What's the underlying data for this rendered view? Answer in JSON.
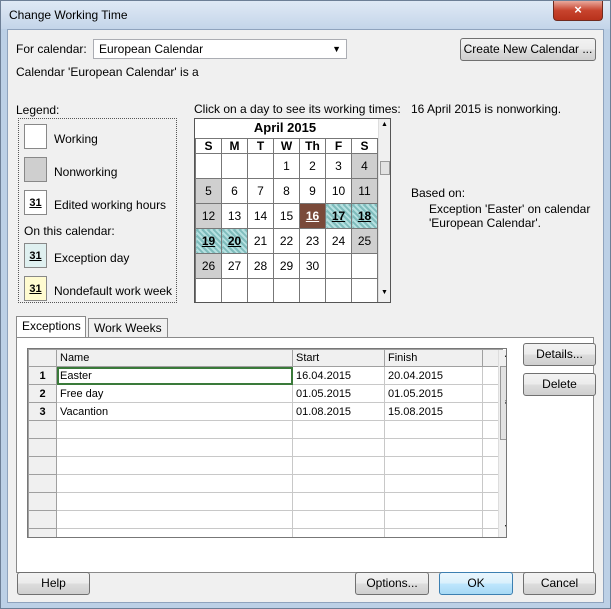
{
  "window": {
    "title": "Change Working Time",
    "close_glyph": "×"
  },
  "for_calendar": {
    "label": "For calendar:",
    "value": "European Calendar"
  },
  "create_calendar_button": "Create New Calendar ...",
  "calendar_info": "Calendar 'European Calendar' is a",
  "legend": {
    "heading": "Legend:",
    "working": "Working",
    "nonworking": "Nonworking",
    "edited": "Edited working hours",
    "sample_day": "31",
    "on_this_calendar": "On this calendar:",
    "exception": "Exception day",
    "nondefault": "Nondefault work week"
  },
  "calendar": {
    "instruction": "Click on a day to see its working times:",
    "month": "April 2015",
    "weekdays": [
      "S",
      "M",
      "T",
      "W",
      "Th",
      "F",
      "S"
    ],
    "weeks": [
      [
        "",
        "",
        "",
        "1",
        "2",
        "3",
        "4"
      ],
      [
        "5",
        "6",
        "7",
        "8",
        "9",
        "10",
        "11"
      ],
      [
        "12",
        "13",
        "14",
        "15",
        "16",
        "17",
        "18"
      ],
      [
        "19",
        "20",
        "21",
        "22",
        "23",
        "24",
        "25"
      ],
      [
        "26",
        "27",
        "28",
        "29",
        "30",
        "",
        ""
      ],
      [
        "",
        "",
        "",
        "",
        "",
        "",
        ""
      ]
    ]
  },
  "info": {
    "status": "16 April 2015 is nonworking.",
    "based_on": "Based on:",
    "exception_text": "Exception 'Easter' on calendar 'European Calendar'."
  },
  "tabs": [
    "Exceptions",
    "Work Weeks"
  ],
  "exceptions_table": {
    "columns": [
      "Name",
      "Start",
      "Finish"
    ],
    "rows": [
      {
        "id": "1",
        "name": "Easter",
        "start": "16.04.2015",
        "finish": "20.04.2015"
      },
      {
        "id": "2",
        "name": "Free day",
        "start": "01.05.2015",
        "finish": "01.05.2015"
      },
      {
        "id": "3",
        "name": "Vacantion",
        "start": "01.08.2015",
        "finish": "15.08.2015"
      }
    ]
  },
  "buttons": {
    "details": "Details...",
    "delete": "Delete",
    "help": "Help",
    "options": "Options...",
    "ok": "OK",
    "cancel": "Cancel"
  },
  "colors": {
    "nonworking": "#cfcfcf",
    "exception": "#9fd2d2",
    "selected": "#7a4a3a",
    "nondefault": "#fffbd0"
  }
}
